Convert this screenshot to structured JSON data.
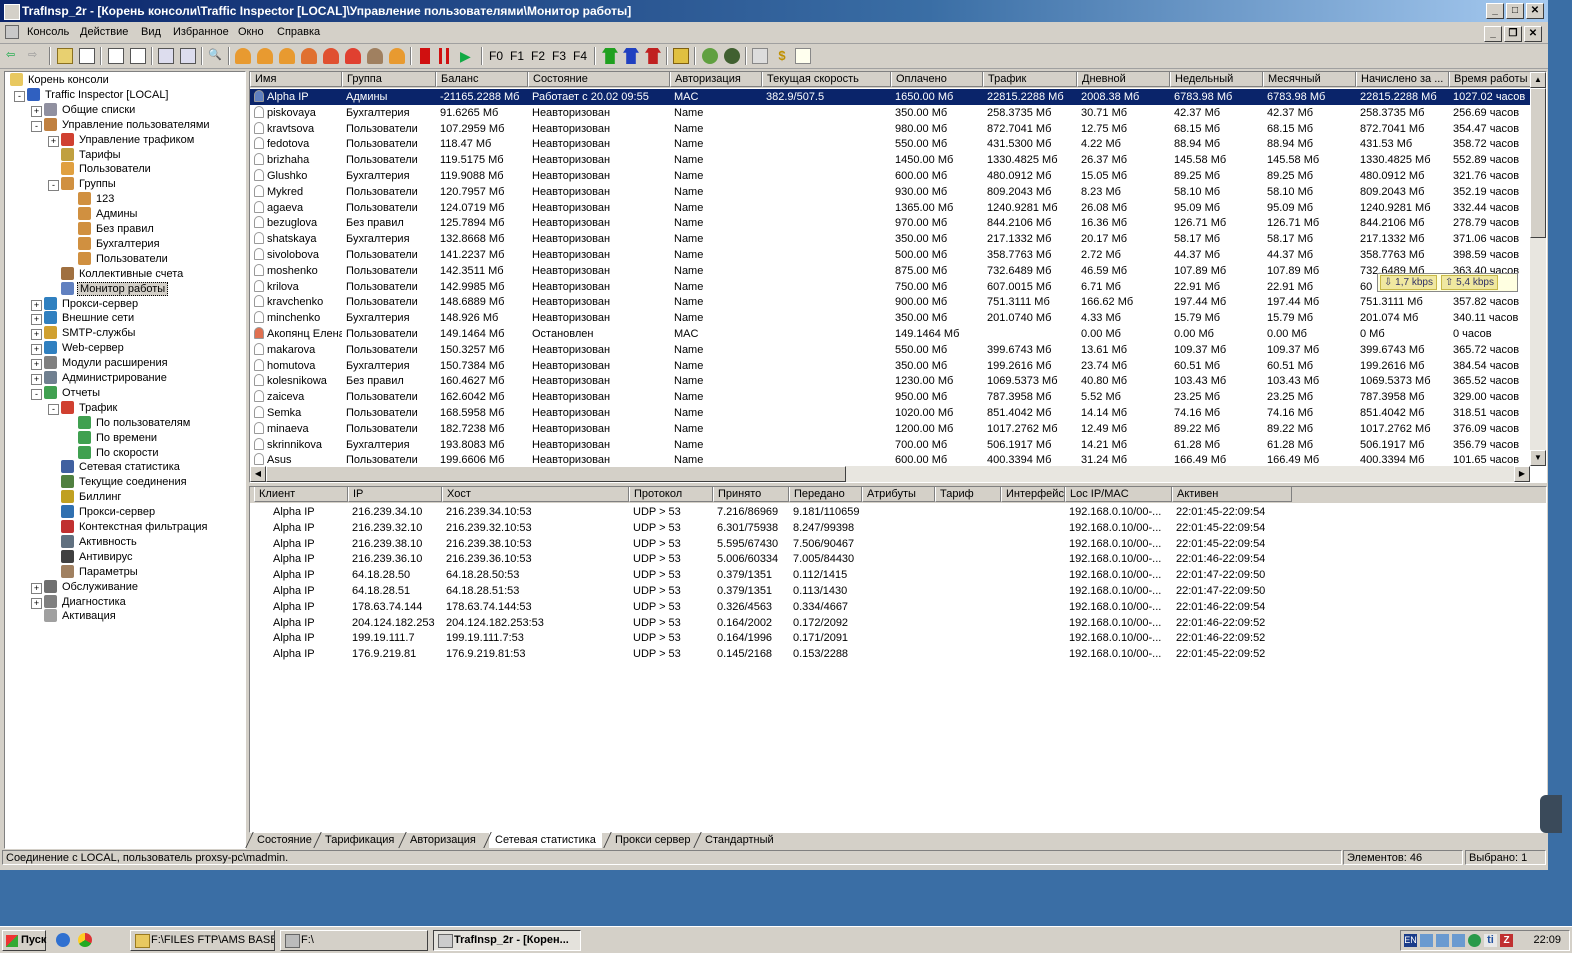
{
  "window": {
    "title": "TrafInsp_2r - [Корень консоли\\Traffic Inspector [LOCAL]\\Управление пользователями\\Монитор работы]"
  },
  "menu": [
    "Консоль",
    "Действие",
    "Вид",
    "Избранное",
    "Окно",
    "Справка"
  ],
  "toolbar": {
    "f_labels": [
      "F0",
      "F1",
      "F2",
      "F3",
      "F4"
    ]
  },
  "tree": [
    {
      "label": "Корень консоли",
      "level": 0,
      "icon": "folder-icon"
    },
    {
      "label": "Traffic Inspector [LOCAL]",
      "level": 1,
      "icon": "shield-icon",
      "exp": "-"
    },
    {
      "label": "Общие списки",
      "level": 2,
      "icon": "list-icon",
      "exp": "+"
    },
    {
      "label": "Управление пользователями",
      "level": 2,
      "icon": "users-icon",
      "exp": "-"
    },
    {
      "label": "Управление трафиком",
      "level": 3,
      "icon": "traffic-icon",
      "exp": "+"
    },
    {
      "label": "Тарифы",
      "level": 3,
      "icon": "tariff-icon"
    },
    {
      "label": "Пользователи",
      "level": 3,
      "icon": "user-icon"
    },
    {
      "label": "Группы",
      "level": 3,
      "icon": "group-icon",
      "exp": "-"
    },
    {
      "label": "123",
      "level": 4,
      "icon": "group-icon"
    },
    {
      "label": "Админы",
      "level": 4,
      "icon": "group-icon"
    },
    {
      "label": "Без правил",
      "level": 4,
      "icon": "group-icon"
    },
    {
      "label": "Бухгалтерия",
      "level": 4,
      "icon": "group-icon"
    },
    {
      "label": "Пользователи",
      "level": 4,
      "icon": "group-icon"
    },
    {
      "label": "Коллективные счета",
      "level": 3,
      "icon": "accounts-icon"
    },
    {
      "label": "Монитор работы",
      "level": 3,
      "icon": "monitor-icon",
      "selected": true
    },
    {
      "label": "Прокси-сервер",
      "level": 2,
      "icon": "globe-icon",
      "exp": "+"
    },
    {
      "label": "Внешние сети",
      "level": 2,
      "icon": "globe-icon",
      "exp": "+"
    },
    {
      "label": "SMTP-службы",
      "level": 2,
      "icon": "mail-icon",
      "exp": "+"
    },
    {
      "label": "Web-сервер",
      "level": 2,
      "icon": "globe-icon",
      "exp": "+"
    },
    {
      "label": "Модули расширения",
      "level": 2,
      "icon": "module-icon",
      "exp": "+"
    },
    {
      "label": "Администрирование",
      "level": 2,
      "icon": "admin-icon",
      "exp": "+"
    },
    {
      "label": "Отчеты",
      "level": 2,
      "icon": "report-icon",
      "exp": "-"
    },
    {
      "label": "Трафик",
      "level": 3,
      "icon": "traffic-icon",
      "exp": "-"
    },
    {
      "label": "По пользователям",
      "level": 4,
      "icon": "report-icon"
    },
    {
      "label": "По времени",
      "level": 4,
      "icon": "report-icon"
    },
    {
      "label": "По скорости",
      "level": 4,
      "icon": "report-icon"
    },
    {
      "label": "Сетевая статистика",
      "level": 3,
      "icon": "stats-icon"
    },
    {
      "label": "Текущие соединения",
      "level": 3,
      "icon": "connections-icon"
    },
    {
      "label": "Биллинг",
      "level": 3,
      "icon": "billing-icon"
    },
    {
      "label": "Прокси-сервер",
      "level": 3,
      "icon": "proxy-icon"
    },
    {
      "label": "Контекстная фильтрация",
      "level": 3,
      "icon": "filter-icon"
    },
    {
      "label": "Активность",
      "level": 3,
      "icon": "activity-icon"
    },
    {
      "label": "Антивирус",
      "level": 3,
      "icon": "antivirus-icon"
    },
    {
      "label": "Параметры",
      "level": 3,
      "icon": "settings-icon"
    },
    {
      "label": "Обслуживание",
      "level": 2,
      "icon": "service-icon",
      "exp": "+"
    },
    {
      "label": "Диагностика",
      "level": 2,
      "icon": "diagnostics-icon",
      "exp": "+"
    },
    {
      "label": "Активация",
      "level": 2,
      "icon": "key-icon"
    }
  ],
  "users_table": {
    "columns": [
      "Имя",
      "Группа",
      "Баланс",
      "Состояние",
      "Авторизация",
      "Текущая скорость",
      "Оплачено",
      "Трафик",
      "Дневной",
      "Недельный",
      "Месячный",
      "Начислено за ...",
      "Время работы"
    ],
    "rows": [
      [
        "Alpha IP",
        "Админы",
        "-21165.2288 Мб",
        "Работает с 20.02 09:55",
        "MAC",
        "382.9/507.5",
        "1650.00 Мб",
        "22815.2288 Мб",
        "2008.38 Мб",
        "6783.98 Мб",
        "6783.98 Мб",
        "22815.2288 Мб",
        "1027.02 часов"
      ],
      [
        "piskovaya",
        "Бухгалтерия",
        "91.6265 Мб",
        "Неавторизован",
        "Name",
        "",
        "350.00 Мб",
        "258.3735 Мб",
        "30.71 Мб",
        "42.37 Мб",
        "42.37 Мб",
        "258.3735 Мб",
        "256.69 часов"
      ],
      [
        "kravtsova",
        "Пользователи",
        "107.2959 Мб",
        "Неавторизован",
        "Name",
        "",
        "980.00 Мб",
        "872.7041 Мб",
        "12.75 Мб",
        "68.15 Мб",
        "68.15 Мб",
        "872.7041 Мб",
        "354.47 часов"
      ],
      [
        "fedotova",
        "Пользователи",
        "118.47 Мб",
        "Неавторизован",
        "Name",
        "",
        "550.00 Мб",
        "431.5300 Мб",
        "4.22 Мб",
        "88.94 Мб",
        "88.94 Мб",
        "431.53 Мб",
        "358.72 часов"
      ],
      [
        "brizhaha",
        "Пользователи",
        "119.5175 Мб",
        "Неавторизован",
        "Name",
        "",
        "1450.00 Мб",
        "1330.4825 Мб",
        "26.37 Мб",
        "145.58 Мб",
        "145.58 Мб",
        "1330.4825 Мб",
        "552.89 часов"
      ],
      [
        "Glushko",
        "Бухгалтерия",
        "119.9088 Мб",
        "Неавторизован",
        "Name",
        "",
        "600.00 Мб",
        "480.0912 Мб",
        "15.05 Мб",
        "89.25 Мб",
        "89.25 Мб",
        "480.0912 Мб",
        "321.76 часов"
      ],
      [
        "Mykred",
        "Пользователи",
        "120.7957 Мб",
        "Неавторизован",
        "Name",
        "",
        "930.00 Мб",
        "809.2043 Мб",
        "8.23 Мб",
        "58.10 Мб",
        "58.10 Мб",
        "809.2043 Мб",
        "352.19 часов"
      ],
      [
        "agaeva",
        "Пользователи",
        "124.0719 Мб",
        "Неавторизован",
        "Name",
        "",
        "1365.00 Мб",
        "1240.9281 Мб",
        "26.08 Мб",
        "95.09 Мб",
        "95.09 Мб",
        "1240.9281 Мб",
        "332.44 часов"
      ],
      [
        "bezuglova",
        "Без правил",
        "125.7894 Мб",
        "Неавторизован",
        "Name",
        "",
        "970.00 Мб",
        "844.2106 Мб",
        "16.36 Мб",
        "126.71 Мб",
        "126.71 Мб",
        "844.2106 Мб",
        "278.79 часов"
      ],
      [
        "shatskaya",
        "Бухгалтерия",
        "132.8668 Мб",
        "Неавторизован",
        "Name",
        "",
        "350.00 Мб",
        "217.1332 Мб",
        "20.17 Мб",
        "58.17 Мб",
        "58.17 Мб",
        "217.1332 Мб",
        "371.06 часов"
      ],
      [
        "sivolobova",
        "Пользователи",
        "141.2237 Мб",
        "Неавторизован",
        "Name",
        "",
        "500.00 Мб",
        "358.7763 Мб",
        "2.72 Мб",
        "44.37 Мб",
        "44.37 Мб",
        "358.7763 Мб",
        "398.59 часов"
      ],
      [
        "moshenko",
        "Пользователи",
        "142.3511 Мб",
        "Неавторизован",
        "Name",
        "",
        "875.00 Мб",
        "732.6489 Мб",
        "46.59 Мб",
        "107.89 Мб",
        "107.89 Мб",
        "732.6489 Мб",
        "363.40 часов"
      ],
      [
        "krilova",
        "Пользователи",
        "142.9985 Мб",
        "Неавторизован",
        "Name",
        "",
        "750.00 Мб",
        "607.0015 Мб",
        "6.71 Мб",
        "22.91 Мб",
        "22.91 Мб",
        "60",
        ""
      ],
      [
        "kravchenko",
        "Пользователи",
        "148.6889 Мб",
        "Неавторизован",
        "Name",
        "",
        "900.00 Мб",
        "751.3111 Мб",
        "166.62 Мб",
        "197.44 Мб",
        "197.44 Мб",
        "751.3111 Мб",
        "357.82 часов"
      ],
      [
        "minchenko",
        "Бухгалтерия",
        "148.926 Мб",
        "Неавторизован",
        "Name",
        "",
        "350.00 Мб",
        "201.0740 Мб",
        "4.33 Мб",
        "15.79 Мб",
        "15.79 Мб",
        "201.074 Мб",
        "340.11 часов"
      ],
      [
        "Акопянц Елена",
        "Пользователи",
        "149.1464 Мб",
        "Остановлен",
        "MAC",
        "",
        "149.1464 Мб",
        "",
        "0.00 Мб",
        "0.00 Мб",
        "0.00 Мб",
        "0 Мб",
        "0 часов"
      ],
      [
        "makarova",
        "Пользователи",
        "150.3257 Мб",
        "Неавторизован",
        "Name",
        "",
        "550.00 Мб",
        "399.6743 Мб",
        "13.61 Мб",
        "109.37 Мб",
        "109.37 Мб",
        "399.6743 Мб",
        "365.72 часов"
      ],
      [
        "homutova",
        "Бухгалтерия",
        "150.7384 Мб",
        "Неавторизован",
        "Name",
        "",
        "350.00 Мб",
        "199.2616 Мб",
        "23.74 Мб",
        "60.51 Мб",
        "60.51 Мб",
        "199.2616 Мб",
        "384.54 часов"
      ],
      [
        "kolesnikowa",
        "Без правил",
        "160.4627 Мб",
        "Неавторизован",
        "Name",
        "",
        "1230.00 Мб",
        "1069.5373 Мб",
        "40.80 Мб",
        "103.43 Мб",
        "103.43 Мб",
        "1069.5373 Мб",
        "365.52 часов"
      ],
      [
        "zaiceva",
        "Пользователи",
        "162.6042 Мб",
        "Неавторизован",
        "Name",
        "",
        "950.00 Мб",
        "787.3958 Мб",
        "5.52 Мб",
        "23.25 Мб",
        "23.25 Мб",
        "787.3958 Мб",
        "329.00 часов"
      ],
      [
        "Semka",
        "Пользователи",
        "168.5958 Мб",
        "Неавторизован",
        "Name",
        "",
        "1020.00 Мб",
        "851.4042 Мб",
        "14.14 Мб",
        "74.16 Мб",
        "74.16 Мб",
        "851.4042 Мб",
        "318.51 часов"
      ],
      [
        "minaeva",
        "Пользователи",
        "182.7238 Мб",
        "Неавторизован",
        "Name",
        "",
        "1200.00 Мб",
        "1017.2762 Мб",
        "12.49 Мб",
        "89.22 Мб",
        "89.22 Мб",
        "1017.2762 Мб",
        "376.09 часов"
      ],
      [
        "skrinnikova",
        "Бухгалтерия",
        "193.8083 Мб",
        "Неавторизован",
        "Name",
        "",
        "700.00 Мб",
        "506.1917 Мб",
        "14.21 Мб",
        "61.28 Мб",
        "61.28 Мб",
        "506.1917 Мб",
        "356.79 часов"
      ],
      [
        "Asus",
        "Пользователи",
        "199.6606 Мб",
        "Неавторизован",
        "Name",
        "",
        "600.00 Мб",
        "400.3394 Мб",
        "31.24 Мб",
        "166.49 Мб",
        "166.49 Мб",
        "400.3394 Мб",
        "101.65 часов"
      ]
    ]
  },
  "speed_tooltip": {
    "down": "1,7 kbps",
    "up": "5,4 kbps"
  },
  "connections_table": {
    "columns": [
      "Клиент",
      "IP",
      "Хост",
      "Протокол",
      "Принято",
      "Передано",
      "Атрибуты",
      "Тариф",
      "Интерфейс",
      "Loc IP/MAC",
      "Активен"
    ],
    "rows": [
      [
        "Alpha IP",
        "216.239.34.10",
        "216.239.34.10:53",
        "UDP > 53",
        "7.216/86969",
        "9.181/110659",
        "",
        "",
        "",
        "192.168.0.10/00-...",
        "22:01:45-22:09:54"
      ],
      [
        "Alpha IP",
        "216.239.32.10",
        "216.239.32.10:53",
        "UDP > 53",
        "6.301/75938",
        "8.247/99398",
        "",
        "",
        "",
        "192.168.0.10/00-...",
        "22:01:45-22:09:54"
      ],
      [
        "Alpha IP",
        "216.239.38.10",
        "216.239.38.10:53",
        "UDP > 53",
        "5.595/67430",
        "7.506/90467",
        "",
        "",
        "",
        "192.168.0.10/00-...",
        "22:01:45-22:09:54"
      ],
      [
        "Alpha IP",
        "216.239.36.10",
        "216.239.36.10:53",
        "UDP > 53",
        "5.006/60334",
        "7.005/84430",
        "",
        "",
        "",
        "192.168.0.10/00-...",
        "22:01:46-22:09:54"
      ],
      [
        "Alpha IP",
        "64.18.28.50",
        "64.18.28.50:53",
        "UDP > 53",
        "0.379/1351",
        "0.112/1415",
        "",
        "",
        "",
        "192.168.0.10/00-...",
        "22:01:47-22:09:50"
      ],
      [
        "Alpha IP",
        "64.18.28.51",
        "64.18.28.51:53",
        "UDP > 53",
        "0.379/1351",
        "0.113/1430",
        "",
        "",
        "",
        "192.168.0.10/00-...",
        "22:01:47-22:09:50"
      ],
      [
        "Alpha IP",
        "178.63.74.144",
        "178.63.74.144:53",
        "UDP > 53",
        "0.326/4563",
        "0.334/4667",
        "",
        "",
        "",
        "192.168.0.10/00-...",
        "22:01:46-22:09:54"
      ],
      [
        "Alpha IP",
        "204.124.182.253",
        "204.124.182.253:53",
        "UDP > 53",
        "0.164/2002",
        "0.172/2092",
        "",
        "",
        "",
        "192.168.0.10/00-...",
        "22:01:46-22:09:52"
      ],
      [
        "Alpha IP",
        "199.19.111.7",
        "199.19.111.7:53",
        "UDP > 53",
        "0.164/1996",
        "0.171/2091",
        "",
        "",
        "",
        "192.168.0.10/00-...",
        "22:01:46-22:09:52"
      ],
      [
        "Alpha IP",
        "176.9.219.81",
        "176.9.219.81:53",
        "UDP > 53",
        "0.145/2168",
        "0.153/2288",
        "",
        "",
        "",
        "192.168.0.10/00-...",
        "22:01:45-22:09:52"
      ]
    ]
  },
  "bottom_tabs": [
    "Состояние",
    "Тарификация",
    "Авторизация",
    "Сетевая статистика",
    "Прокси сервер",
    "Стандартный"
  ],
  "active_tab": "Сетевая статистика",
  "statusbar": {
    "connection": "Соединение с LOCAL, пользователь proxsy-pc\\madmin.",
    "elements": "Элементов: 46",
    "selected": "Выбрано: 1"
  },
  "taskbar": {
    "start": "Пуск",
    "buttons": [
      "F:\\FILES FTP\\AMS BASE\\...",
      "F:\\",
      "TrafInsp_2r - [Корен..."
    ],
    "lang": "EN",
    "clock": "22:09"
  }
}
